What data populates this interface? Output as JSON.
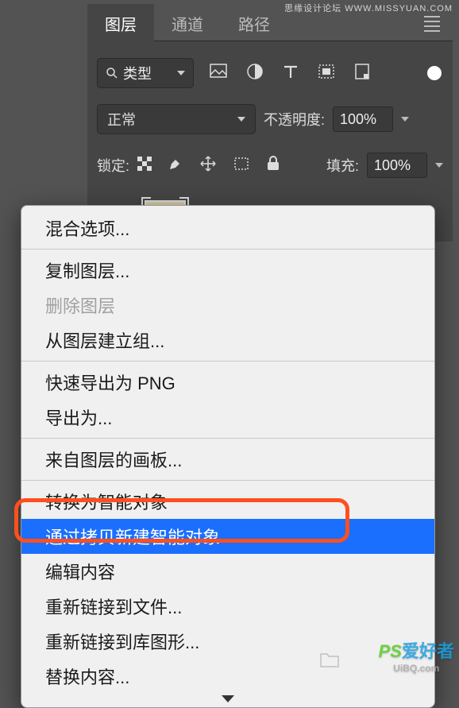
{
  "tabs": {
    "layers": "图层",
    "channels": "通道",
    "paths": "路径"
  },
  "filter": {
    "type_label": "类型"
  },
  "blend": {
    "mode": "正常",
    "opacity_label": "不透明度:",
    "opacity_value": "100%"
  },
  "lock": {
    "label": "锁定:",
    "fill_label": "填充:",
    "fill_value": "100%"
  },
  "menu": {
    "blend_options": "混合选项...",
    "copy_layer": "复制图层...",
    "delete_layer": "删除图层",
    "group_from_layers": "从图层建立组...",
    "quick_export_png": "快速导出为 PNG",
    "export_as": "导出为...",
    "artboard_from_layers": "来自图层的画板...",
    "convert_smart": "转换为智能对象",
    "new_smart_via_copy": "通过拷贝新建智能对象",
    "edit_contents": "编辑内容",
    "relink_file": "重新链接到文件...",
    "relink_library": "重新链接到库图形...",
    "replace_contents": "替换内容..."
  },
  "watermark": {
    "top": "思缘设计论坛  WWW.MISSYUAN.COM",
    "bottom_brand": "PS",
    "bottom_text": "爱好者",
    "bottom_url": "UiBQ.com"
  }
}
